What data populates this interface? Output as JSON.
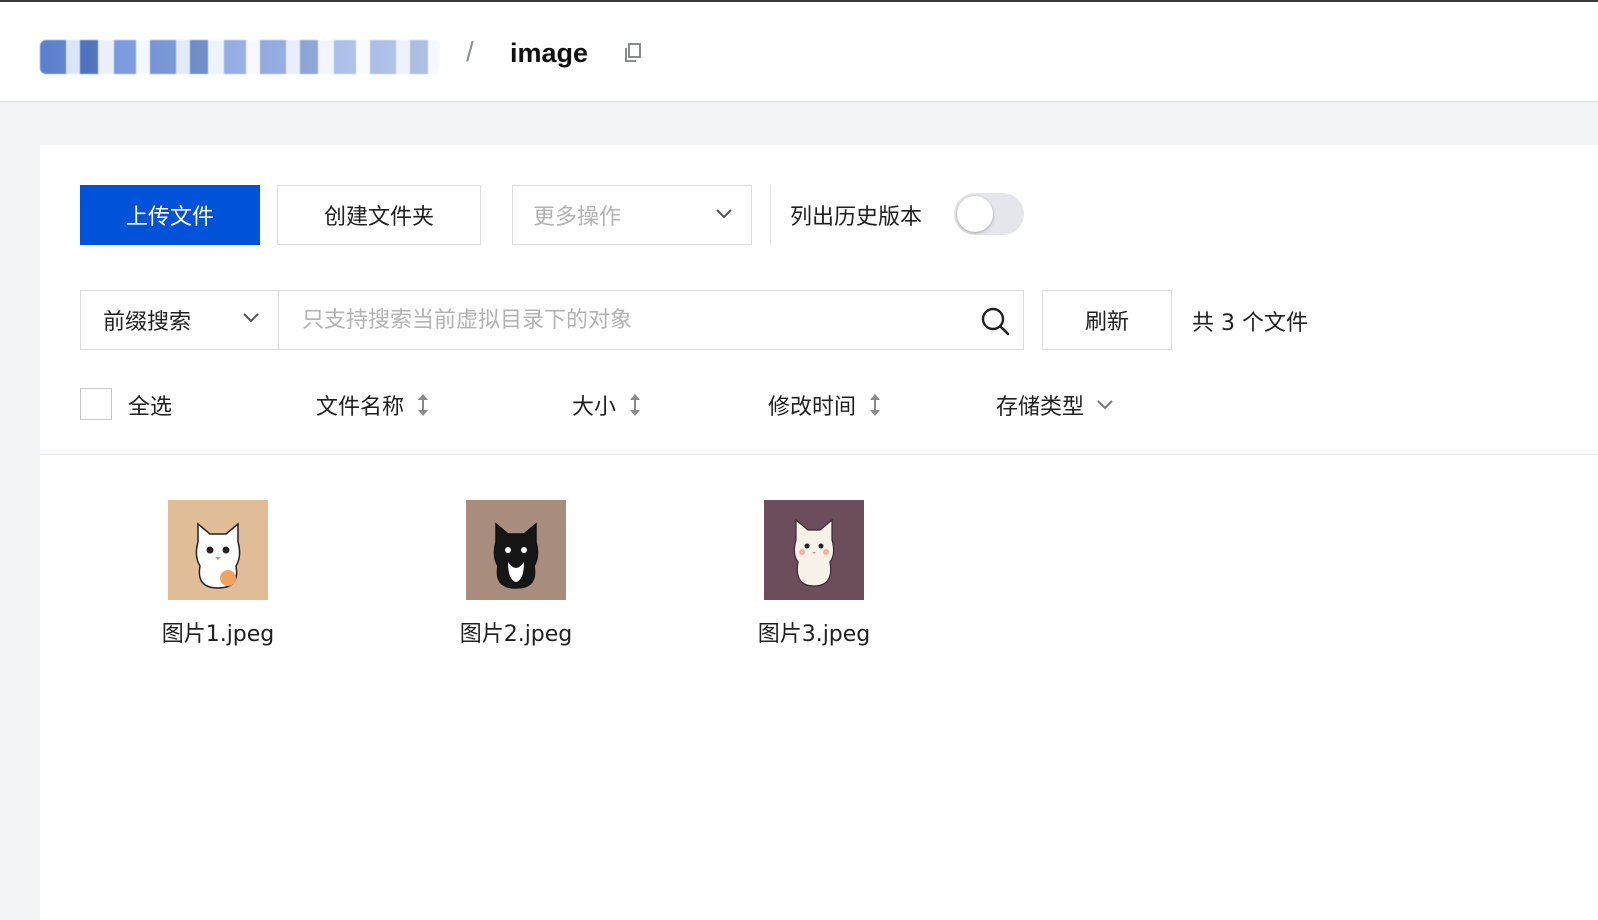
{
  "header": {
    "current_folder": "image",
    "separator": "/"
  },
  "toolbar": {
    "upload_label": "上传文件",
    "create_folder_label": "创建文件夹",
    "more_actions_label": "更多操作",
    "history_label": "列出历史版本",
    "history_enabled": false
  },
  "search": {
    "type_label": "前缀搜索",
    "placeholder": "只支持搜索当前虚拟目录下的对象",
    "value": "",
    "refresh_label": "刷新",
    "count_label": "共 3 个文件"
  },
  "list_header": {
    "select_all": "全选",
    "name": "文件名称",
    "size": "大小",
    "modified": "修改时间",
    "storage": "存储类型"
  },
  "files": [
    {
      "name": "图片1.jpeg",
      "thumb_bg": "#e0bc97",
      "cat_color": "#ffffff"
    },
    {
      "name": "图片2.jpeg",
      "thumb_bg": "#a88c7e",
      "cat_color": "#161616"
    },
    {
      "name": "图片3.jpeg",
      "thumb_bg": "#6b4d5c",
      "cat_color": "#f6f2ea"
    }
  ],
  "colors": {
    "primary": "#0052d9",
    "border": "#dcdcdc",
    "placeholder": "#b3b3b3"
  }
}
